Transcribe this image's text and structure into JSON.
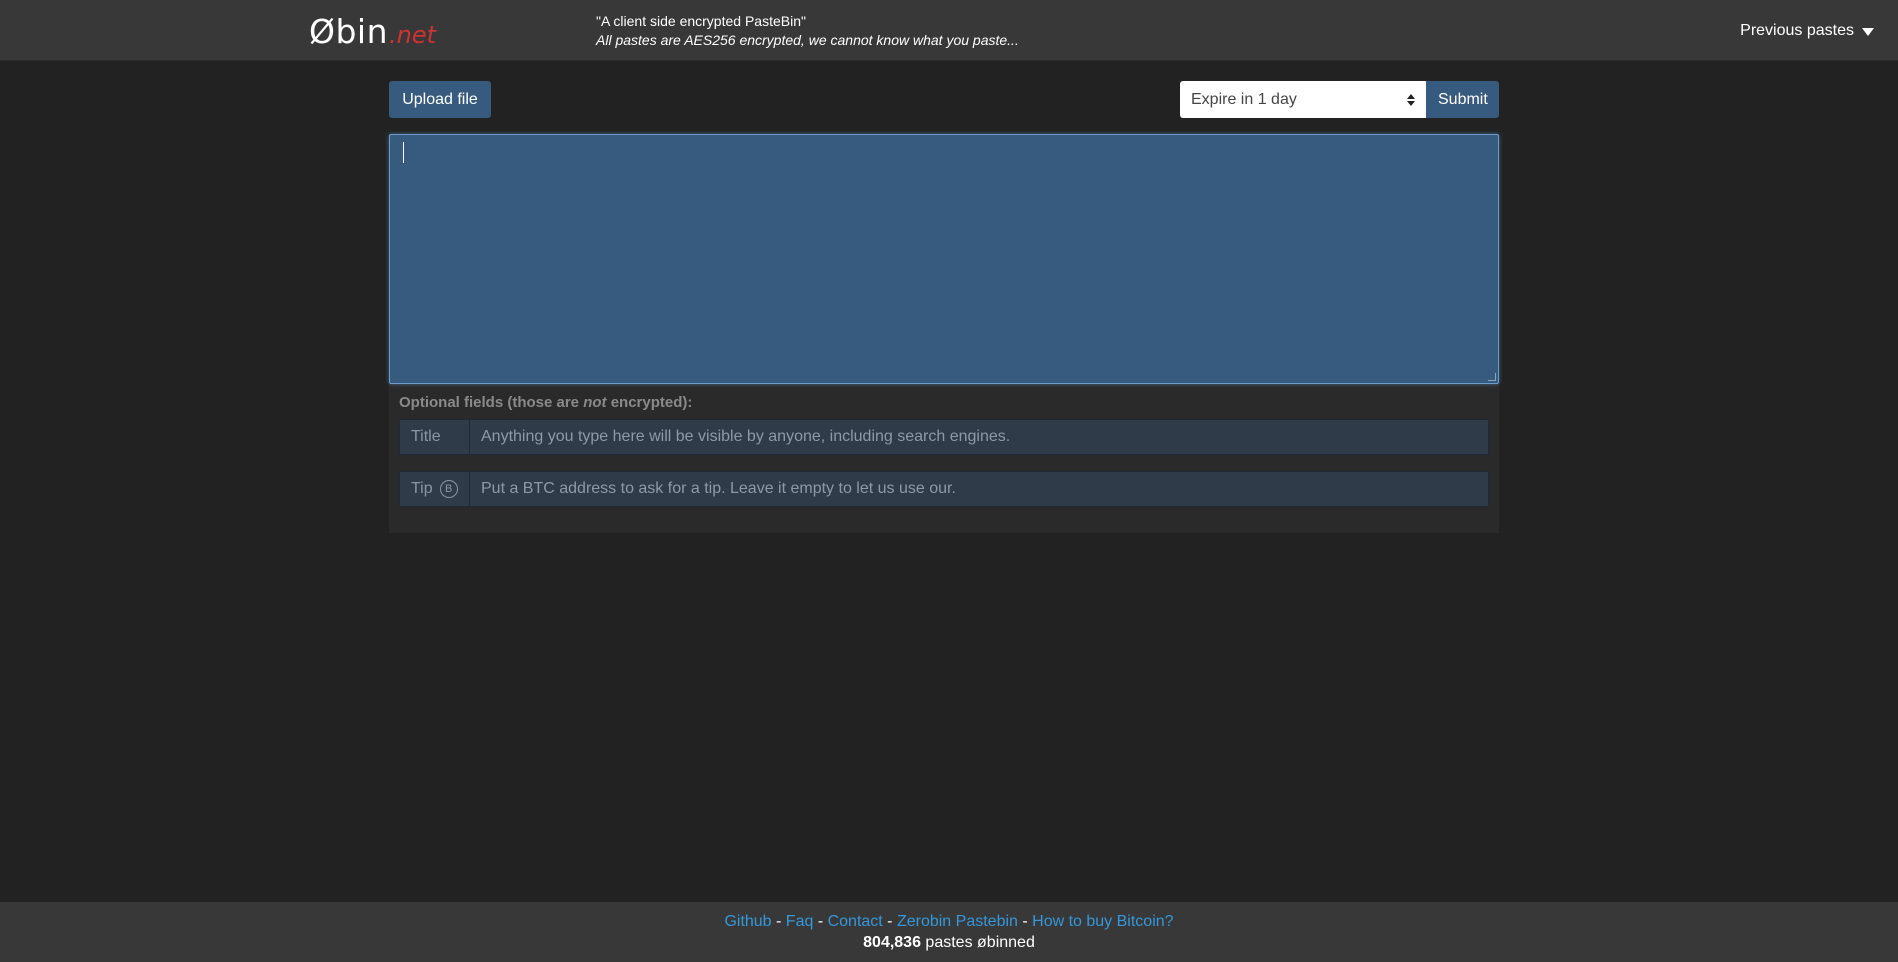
{
  "header": {
    "brand_main": "Øbin",
    "brand_tld": ".net",
    "tagline_1": "\"A client side encrypted PasteBin\"",
    "tagline_2": "All pastes are AES256 encrypted, we cannot know what you paste...",
    "previous_pastes": "Previous pastes"
  },
  "toolbar": {
    "upload_label": "Upload file",
    "expire_value": "Expire in 1 day",
    "submit_label": "Submit"
  },
  "paste": {
    "content": ""
  },
  "optional": {
    "label_prefix": "Optional fields (those are ",
    "label_em": "not",
    "label_suffix": " encrypted):",
    "title_addon": "Title",
    "title_placeholder": "Anything you type here will be visible by anyone, including search engines.",
    "tip_addon": "Tip",
    "tip_icon": "B",
    "tip_placeholder": "Put a BTC address to ask for a tip. Leave it empty to let us use our."
  },
  "footer": {
    "links": [
      "Github",
      "Faq",
      "Contact",
      "Zerobin Pastebin",
      "How to buy Bitcoin?"
    ],
    "separator": " - ",
    "count": "804,836",
    "count_suffix": " pastes øbinned"
  },
  "colors": {
    "accent": "#375a7f",
    "brand_tld": "#cf3232",
    "link": "#3498db",
    "background": "#222222"
  }
}
